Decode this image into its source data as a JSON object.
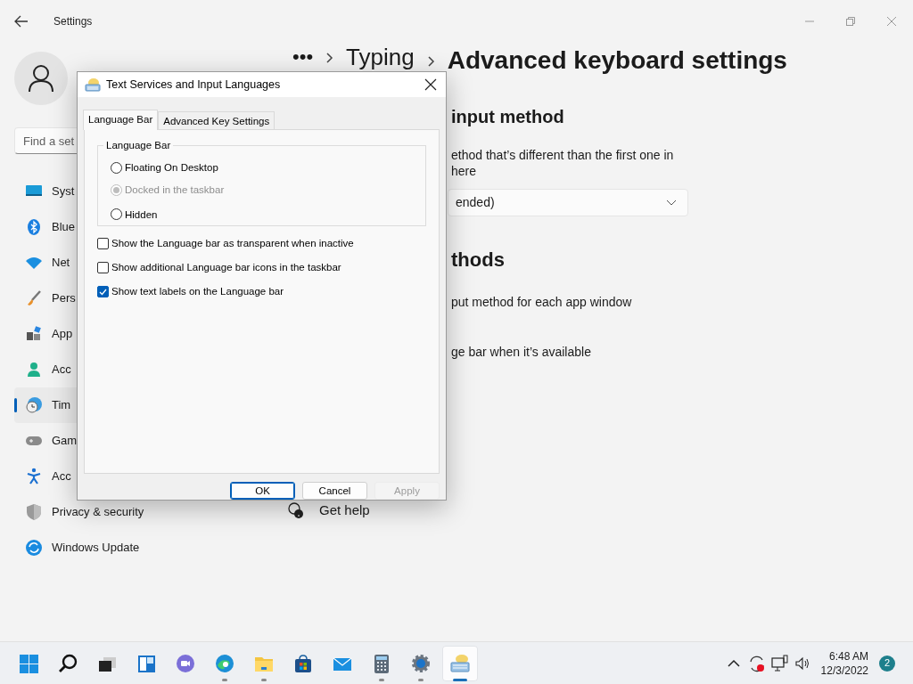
{
  "window": {
    "title": "Settings"
  },
  "search": {
    "placeholder": "Find a set"
  },
  "sidebar": {
    "items": [
      {
        "label": "Syst",
        "selected": false
      },
      {
        "label": "Blue",
        "selected": false
      },
      {
        "label": "Net",
        "selected": false
      },
      {
        "label": "Pers",
        "selected": false
      },
      {
        "label": "App",
        "selected": false
      },
      {
        "label": "Acc",
        "selected": false
      },
      {
        "label": "Tim",
        "selected": true
      },
      {
        "label": "Gam",
        "selected": false
      },
      {
        "label": "Acc",
        "selected": false
      },
      {
        "label": "Privacy & security",
        "selected": false
      },
      {
        "label": "Windows Update",
        "selected": false
      }
    ]
  },
  "breadcrumb": {
    "more": "•••",
    "parent": "Typing",
    "title": "Advanced keyboard settings"
  },
  "content": {
    "sections": [
      {
        "heading": "input method",
        "lines": [
          "ethod that’s different than the first one in",
          "here"
        ],
        "dropdown": {
          "value": "ended)"
        }
      },
      {
        "heading": "thods",
        "lines": [
          "put method for each app window",
          "ge bar when it’s available"
        ]
      }
    ],
    "help": "Get help"
  },
  "dialog": {
    "title": "Text Services and Input Languages",
    "tabs": [
      {
        "label": "Language Bar",
        "selected": true
      },
      {
        "label": "Advanced Key Settings",
        "selected": false
      }
    ],
    "group": {
      "legend": "Language Bar",
      "options": [
        {
          "label": "Floating On Desktop",
          "selected": false,
          "disabled": false
        },
        {
          "label": "Docked in the taskbar",
          "selected": true,
          "disabled": true
        },
        {
          "label": "Hidden",
          "selected": false,
          "disabled": false
        }
      ]
    },
    "checkboxes": [
      {
        "label": "Show the Language bar as transparent when inactive",
        "checked": false
      },
      {
        "label": "Show additional Language bar icons in the taskbar",
        "checked": false
      },
      {
        "label": "Show text labels on the Language bar",
        "checked": true
      }
    ],
    "buttons": [
      {
        "label": "OK",
        "default": true,
        "disabled": false
      },
      {
        "label": "Cancel",
        "default": false,
        "disabled": false
      },
      {
        "label": "Apply",
        "default": false,
        "disabled": true
      }
    ]
  },
  "taskbar": {
    "apps": [
      {
        "kind": "start",
        "running": false,
        "active": false
      },
      {
        "kind": "search",
        "running": false,
        "active": false
      },
      {
        "kind": "taskview",
        "running": false,
        "active": false
      },
      {
        "kind": "widgets",
        "running": false,
        "active": false
      },
      {
        "kind": "chat",
        "running": false,
        "active": false
      },
      {
        "kind": "edge",
        "running": true,
        "active": false
      },
      {
        "kind": "explorer",
        "running": true,
        "active": false
      },
      {
        "kind": "store",
        "running": false,
        "active": false
      },
      {
        "kind": "mail",
        "running": false,
        "active": false
      },
      {
        "kind": "calculator",
        "running": true,
        "active": false
      },
      {
        "kind": "settings",
        "running": true,
        "active": false
      },
      {
        "kind": "langbar",
        "running": true,
        "active": true
      }
    ]
  },
  "tray": {
    "time": "6:48 AM",
    "date": "12/3/2022",
    "notifications": "2"
  }
}
